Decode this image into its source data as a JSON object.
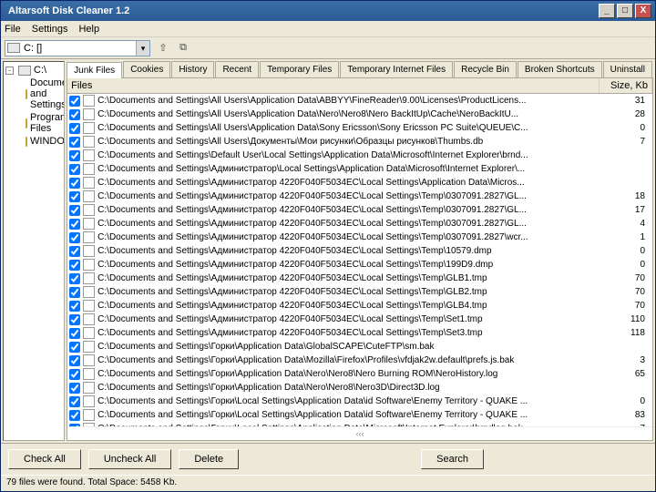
{
  "title": "Altarsoft Disk Cleaner 1.2",
  "menu": {
    "file": "File",
    "settings": "Settings",
    "help": "Help"
  },
  "drive_selected": "C: []",
  "tree": {
    "root": "C:\\",
    "children": [
      {
        "label": "Documents and Settings"
      },
      {
        "label": "Program Files"
      },
      {
        "label": "WINDOWS"
      }
    ]
  },
  "tabs": [
    "Junk Files",
    "Cookies",
    "History",
    "Recent",
    "Temporary Files",
    "Temporary Internet Files",
    "Recycle Bin",
    "Broken Shortcuts",
    "Uninstall"
  ],
  "active_tab": 0,
  "columns": {
    "files": "Files",
    "size": "Size, Kb"
  },
  "rows": [
    {
      "path": "C:\\Documents and Settings\\All Users\\Application Data\\ABBYY\\FineReader\\9.00\\Licenses\\ProductLicens...",
      "size": "31"
    },
    {
      "path": "C:\\Documents and Settings\\All Users\\Application Data\\Nero\\Nero8\\Nero BackItUp\\Cache\\NeroBackItU...",
      "size": "28"
    },
    {
      "path": "C:\\Documents and Settings\\All Users\\Application Data\\Sony Ericsson\\Sony Ericsson PC Suite\\QUEUE\\C...",
      "size": "0"
    },
    {
      "path": "C:\\Documents and Settings\\All Users\\Документы\\Мои рисунки\\Образцы рисунков\\Thumbs.db",
      "size": "7"
    },
    {
      "path": "C:\\Documents and Settings\\Default User\\Local Settings\\Application Data\\Microsoft\\Internet Explorer\\brnd...",
      "size": ""
    },
    {
      "path": "C:\\Documents and Settings\\Администратор\\Local Settings\\Application Data\\Microsoft\\Internet Explorer\\...",
      "size": ""
    },
    {
      "path": "C:\\Documents and Settings\\Администратор 4220F040F5034EC\\Local Settings\\Application Data\\Micros...",
      "size": ""
    },
    {
      "path": "C:\\Documents and Settings\\Администратор 4220F040F5034EC\\Local Settings\\Temp\\0307091.2827\\GL...",
      "size": "18"
    },
    {
      "path": "C:\\Documents and Settings\\Администратор 4220F040F5034EC\\Local Settings\\Temp\\0307091.2827\\GL...",
      "size": "17"
    },
    {
      "path": "C:\\Documents and Settings\\Администратор 4220F040F5034EC\\Local Settings\\Temp\\0307091.2827\\GL...",
      "size": "4"
    },
    {
      "path": "C:\\Documents and Settings\\Администратор 4220F040F5034EC\\Local Settings\\Temp\\0307091.2827\\wcr...",
      "size": "1"
    },
    {
      "path": "C:\\Documents and Settings\\Администратор 4220F040F5034EC\\Local Settings\\Temp\\10579.dmp",
      "size": "0"
    },
    {
      "path": "C:\\Documents and Settings\\Администратор 4220F040F5034EC\\Local Settings\\Temp\\199D9.dmp",
      "size": "0"
    },
    {
      "path": "C:\\Documents and Settings\\Администратор 4220F040F5034EC\\Local Settings\\Temp\\GLB1.tmp",
      "size": "70"
    },
    {
      "path": "C:\\Documents and Settings\\Администратор 4220F040F5034EC\\Local Settings\\Temp\\GLB2.tmp",
      "size": "70"
    },
    {
      "path": "C:\\Documents and Settings\\Администратор 4220F040F5034EC\\Local Settings\\Temp\\GLB4.tmp",
      "size": "70"
    },
    {
      "path": "C:\\Documents and Settings\\Администратор 4220F040F5034EC\\Local Settings\\Temp\\Set1.tmp",
      "size": "110"
    },
    {
      "path": "C:\\Documents and Settings\\Администратор 4220F040F5034EC\\Local Settings\\Temp\\Set3.tmp",
      "size": "118"
    },
    {
      "path": "C:\\Documents and Settings\\Горки\\Application Data\\GlobalSCAPE\\CuteFTP\\sm.bak",
      "size": ""
    },
    {
      "path": "C:\\Documents and Settings\\Горки\\Application Data\\Mozilla\\Firefox\\Profiles\\vfdjak2w.default\\prefs.js.bak",
      "size": "3"
    },
    {
      "path": "C:\\Documents and Settings\\Горки\\Application Data\\Nero\\Nero8\\Nero Burning ROM\\NeroHistory.log",
      "size": "65"
    },
    {
      "path": "C:\\Documents and Settings\\Горки\\Application Data\\Nero\\Nero8\\Nero3D\\Direct3D.log",
      "size": ""
    },
    {
      "path": "C:\\Documents and Settings\\Горки\\Local Settings\\Application Data\\id Software\\Enemy Territory - QUAKE ...",
      "size": "0"
    },
    {
      "path": "C:\\Documents and Settings\\Горки\\Local Settings\\Application Data\\id Software\\Enemy Territory - QUAKE ...",
      "size": "83"
    },
    {
      "path": "C:\\Documents and Settings\\Горки\\Local Settings\\Application Data\\Microsoft\\Internet Explorer\\brndlog.bak",
      "size": "7"
    }
  ],
  "buttons": {
    "check_all": "Check All",
    "uncheck_all": "Uncheck All",
    "delete": "Delete",
    "search": "Search"
  },
  "status": "79 files were found. Total Space: 5458 Kb.",
  "scroll_hint": "‹‹‹"
}
